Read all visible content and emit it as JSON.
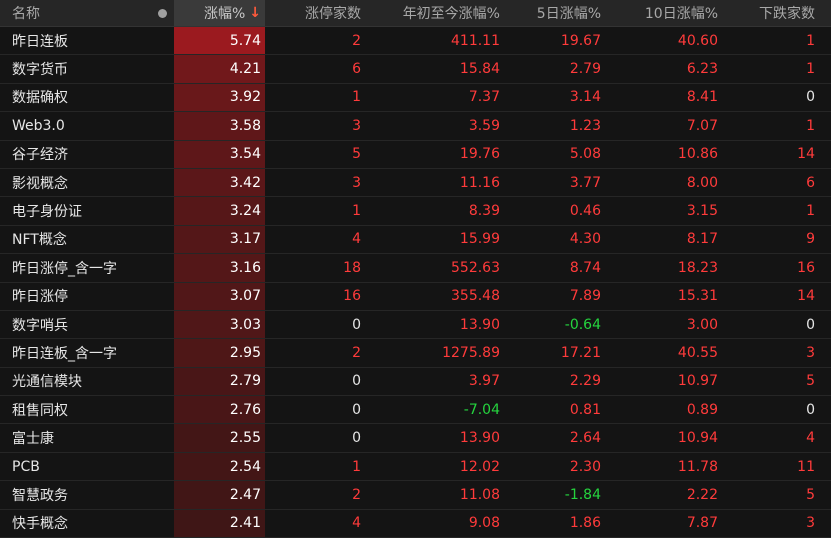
{
  "colors": {
    "up": "#ff3b3b",
    "down": "#25d43e",
    "bar_strong": "#9b1a1f",
    "bar_weak": "#3f1616"
  },
  "header": {
    "name": "名称",
    "change_pct": "涨幅%",
    "sort_icon": "arrow-down",
    "limit_up_count": "涨停家数",
    "ytd_pct": "年初至今涨幅%",
    "d5_pct": "5日涨幅%",
    "d10_pct": "10日涨幅%",
    "down_count": "下跌家数"
  },
  "rows": [
    {
      "name": "昨日连板",
      "chg": "5.74",
      "limit": "2",
      "ytd": "411.11",
      "d5": "19.67",
      "d10": "40.60",
      "down": "1"
    },
    {
      "name": "数字货币",
      "chg": "4.21",
      "limit": "6",
      "ytd": "15.84",
      "d5": "2.79",
      "d10": "6.23",
      "down": "1"
    },
    {
      "name": "数据确权",
      "chg": "3.92",
      "limit": "1",
      "ytd": "7.37",
      "d5": "3.14",
      "d10": "8.41",
      "down": "0"
    },
    {
      "name": "Web3.0",
      "chg": "3.58",
      "limit": "3",
      "ytd": "3.59",
      "d5": "1.23",
      "d10": "7.07",
      "down": "1"
    },
    {
      "name": "谷子经济",
      "chg": "3.54",
      "limit": "5",
      "ytd": "19.76",
      "d5": "5.08",
      "d10": "10.86",
      "down": "14"
    },
    {
      "name": "影视概念",
      "chg": "3.42",
      "limit": "3",
      "ytd": "11.16",
      "d5": "3.77",
      "d10": "8.00",
      "down": "6"
    },
    {
      "name": "电子身份证",
      "chg": "3.24",
      "limit": "1",
      "ytd": "8.39",
      "d5": "0.46",
      "d10": "3.15",
      "down": "1"
    },
    {
      "name": "NFT概念",
      "chg": "3.17",
      "limit": "4",
      "ytd": "15.99",
      "d5": "4.30",
      "d10": "8.17",
      "down": "9"
    },
    {
      "name": "昨日涨停_含一字",
      "chg": "3.16",
      "limit": "18",
      "ytd": "552.63",
      "d5": "8.74",
      "d10": "18.23",
      "down": "16"
    },
    {
      "name": "昨日涨停",
      "chg": "3.07",
      "limit": "16",
      "ytd": "355.48",
      "d5": "7.89",
      "d10": "15.31",
      "down": "14"
    },
    {
      "name": "数字哨兵",
      "chg": "3.03",
      "limit": "0",
      "ytd": "13.90",
      "d5": "-0.64",
      "d10": "3.00",
      "down": "0"
    },
    {
      "name": "昨日连板_含一字",
      "chg": "2.95",
      "limit": "2",
      "ytd": "1275.89",
      "d5": "17.21",
      "d10": "40.55",
      "down": "3"
    },
    {
      "name": "光通信模块",
      "chg": "2.79",
      "limit": "0",
      "ytd": "3.97",
      "d5": "2.29",
      "d10": "10.97",
      "down": "5"
    },
    {
      "name": "租售同权",
      "chg": "2.76",
      "limit": "0",
      "ytd": "-7.04",
      "d5": "0.81",
      "d10": "0.89",
      "down": "0"
    },
    {
      "name": "富士康",
      "chg": "2.55",
      "limit": "0",
      "ytd": "13.90",
      "d5": "2.64",
      "d10": "10.94",
      "down": "4"
    },
    {
      "name": "PCB",
      "chg": "2.54",
      "limit": "1",
      "ytd": "12.02",
      "d5": "2.30",
      "d10": "11.78",
      "down": "11"
    },
    {
      "name": "智慧政务",
      "chg": "2.47",
      "limit": "2",
      "ytd": "11.08",
      "d5": "-1.84",
      "d10": "2.22",
      "down": "5"
    },
    {
      "name": "快手概念",
      "chg": "2.41",
      "limit": "4",
      "ytd": "9.08",
      "d5": "1.86",
      "d10": "7.87",
      "down": "3"
    }
  ]
}
